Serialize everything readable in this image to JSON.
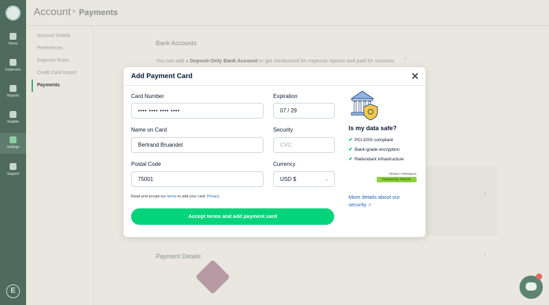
{
  "nav": {
    "items": [
      {
        "label": "Home",
        "active": false
      },
      {
        "label": "Expenses",
        "active": false
      },
      {
        "label": "Reports",
        "active": false
      },
      {
        "label": "Insights",
        "active": false
      },
      {
        "label": "Settings",
        "active": true
      },
      {
        "label": "Support",
        "active": false
      }
    ],
    "brand_letter": "E"
  },
  "header": {
    "crumb_parent": "Account",
    "separator": ">",
    "crumb_current": "Payments"
  },
  "subnav": {
    "items": [
      "Account Details",
      "Preferences",
      "Expense Rules",
      "Credit Card Import",
      "Payments"
    ],
    "active": "Payments"
  },
  "page": {
    "bank_title": "Bank Accounts",
    "bank_text_pre": "You can add a ",
    "bank_text_bold": "Deposit-Only Bank Account",
    "bank_text_post": " to get reimbursed for expense reports and paid for invoices.",
    "payment_title": "Payment Details"
  },
  "modal": {
    "title": "Add Payment Card",
    "fields": {
      "card_number": {
        "label": "Card Number",
        "value": "•••• •••• •••• ••••"
      },
      "expiration": {
        "label": "Expiration",
        "value": "07 / 29"
      },
      "name": {
        "label": "Name on Card",
        "value": "Bertrand Bruandet"
      },
      "security": {
        "label": "Security",
        "placeholder": "CVC"
      },
      "postal": {
        "label": "Postal Code",
        "value": "75001"
      },
      "currency": {
        "label": "Currency",
        "value": "USD $"
      }
    },
    "terms": {
      "pre": "Read and accept our ",
      "link1": "terms",
      "mid": " to add your card. ",
      "link2": "Privacy"
    },
    "submit_label": "Accept terms and add payment card",
    "safe": {
      "title": "Is my data safe?",
      "points": [
        "PCI-DSS compliant",
        "Bank-grade encryption",
        "Redundant infrastructure"
      ],
      "truste_top": "PRIVACY FEEDBACK",
      "truste_bottom": "Powered by TRUSTe",
      "more_link": "More details about our security"
    }
  },
  "colors": {
    "accent_green": "#03d47c",
    "rail_bg": "#4f6b5d",
    "link_blue": "#1b5fb0"
  }
}
